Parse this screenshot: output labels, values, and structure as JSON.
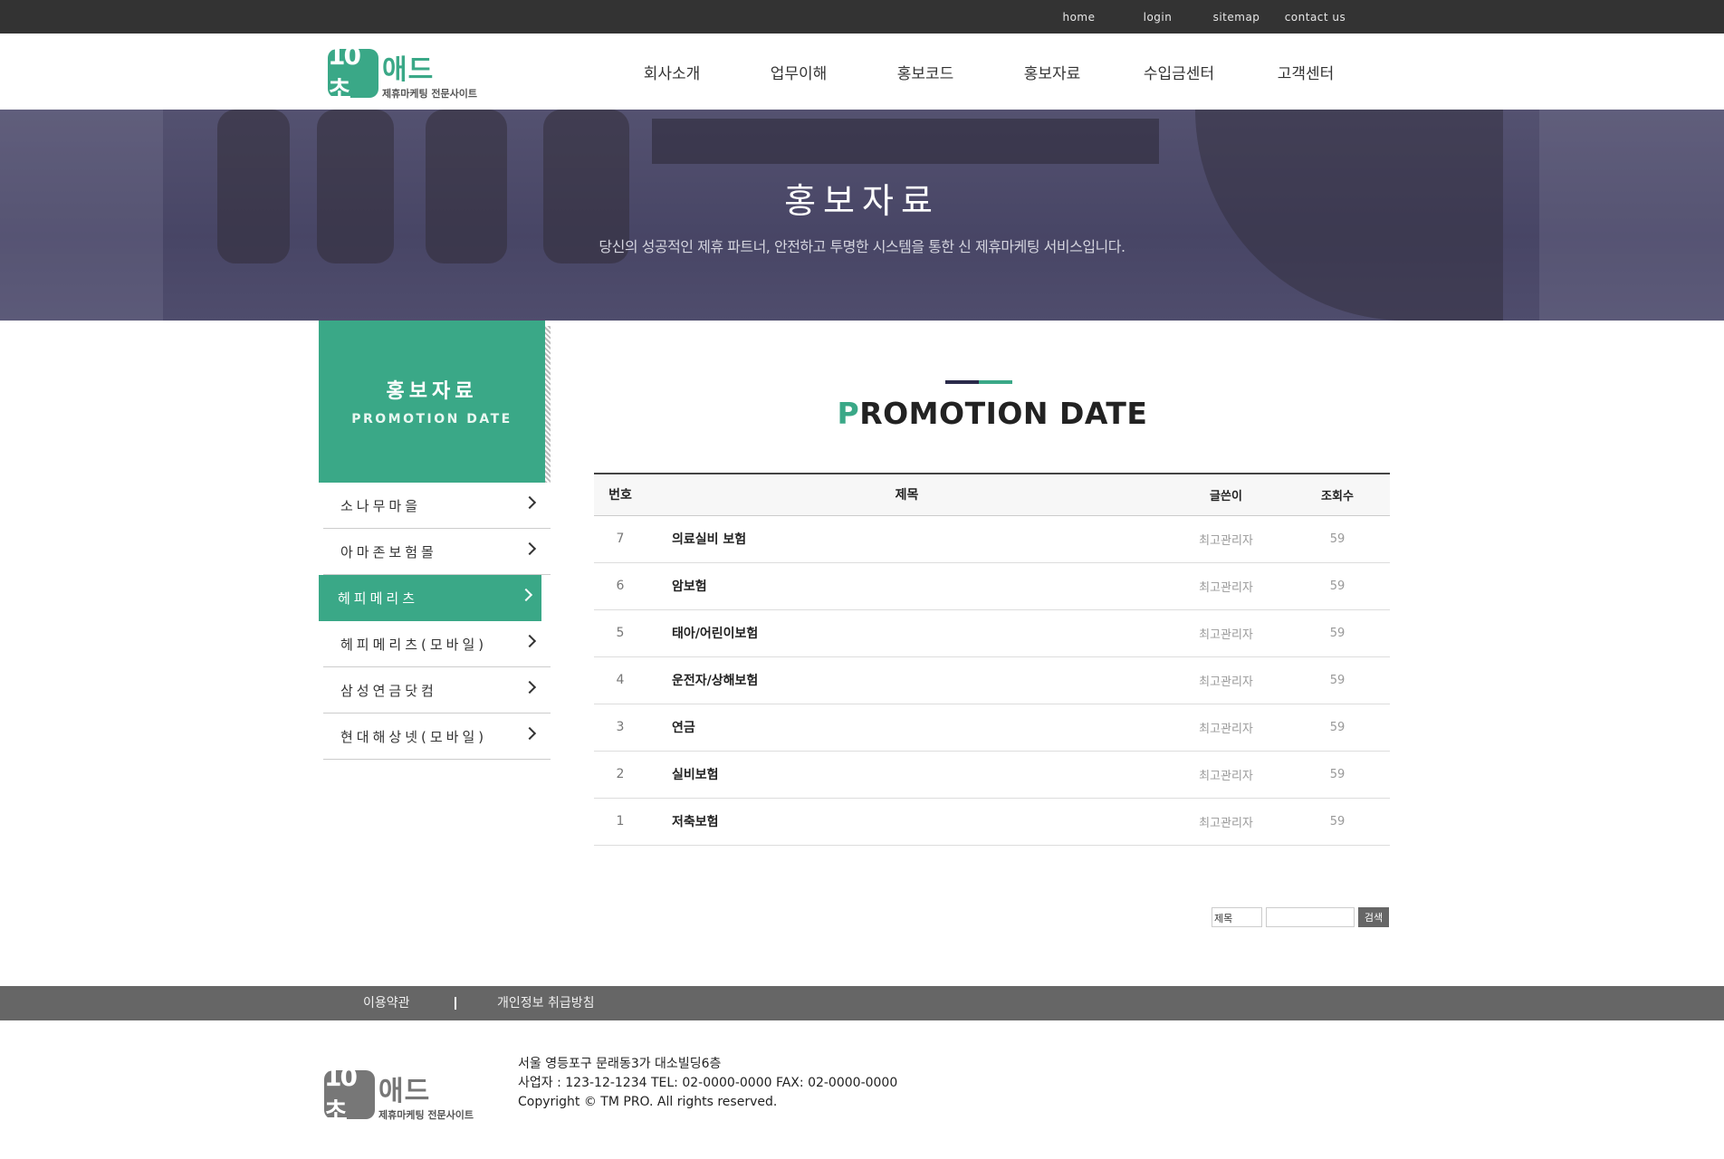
{
  "topbar": {
    "links": [
      "home",
      "login",
      "sitemap",
      "contact us"
    ]
  },
  "header": {
    "logo": {
      "mark": "10초",
      "name": "애드",
      "tagline": "제휴마케팅 전문사이트"
    },
    "nav": [
      "회사소개",
      "업무이해",
      "홍보코드",
      "홍보자료",
      "수입금센터",
      "고객센터"
    ]
  },
  "hero": {
    "title": "홍보자료",
    "subtitle": "당신의 성공적인 제휴 파트너, 안전하고 투명한 시스템을 통한 신 제휴마케팅 서비스입니다."
  },
  "sidebar": {
    "title": "홍보자료",
    "subtitle": "PROMOTION DATE",
    "items": [
      {
        "label": "소나무마을",
        "active": false
      },
      {
        "label": "아마존보험몰",
        "active": false
      },
      {
        "label": "헤피메리츠",
        "active": true
      },
      {
        "label": "헤피메리츠(모바일)",
        "active": false
      },
      {
        "label": "삼성연금닷컴",
        "active": false
      },
      {
        "label": "현대해상넷(모바일)",
        "active": false
      }
    ]
  },
  "content": {
    "title_first": "P",
    "title_rest": "ROMOTION DATE",
    "columns": {
      "no": "번호",
      "title": "제목",
      "writer": "글쓴이",
      "hits": "조회수"
    },
    "rows": [
      {
        "no": "7",
        "title": "의료실비 보험",
        "writer": "최고관리자",
        "hits": "59"
      },
      {
        "no": "6",
        "title": "암보험",
        "writer": "최고관리자",
        "hits": "59"
      },
      {
        "no": "5",
        "title": "태아/어린이보험",
        "writer": "최고관리자",
        "hits": "59"
      },
      {
        "no": "4",
        "title": "운전자/상해보험",
        "writer": "최고관리자",
        "hits": "59"
      },
      {
        "no": "3",
        "title": "연금",
        "writer": "최고관리자",
        "hits": "59"
      },
      {
        "no": "2",
        "title": "실비보험",
        "writer": "최고관리자",
        "hits": "59"
      },
      {
        "no": "1",
        "title": "저축보험",
        "writer": "최고관리자",
        "hits": "59"
      }
    ],
    "search": {
      "field": "제목",
      "value": "",
      "button": "검색"
    }
  },
  "footer": {
    "links": [
      "이용약관",
      "개인정보 취급방침"
    ],
    "address": "서울 영등포구 문래동3가 대소빌딩6층",
    "business": "사업자 : 123-12-1234 TEL: 02-0000-0000 FAX: 02-0000-0000",
    "copyright": "Copyright © TM PRO. All rights reserved."
  },
  "colors": {
    "accent": "#3aa887",
    "topbar": "#333333",
    "footbar": "#666666",
    "navy": "#2a2a4a"
  }
}
